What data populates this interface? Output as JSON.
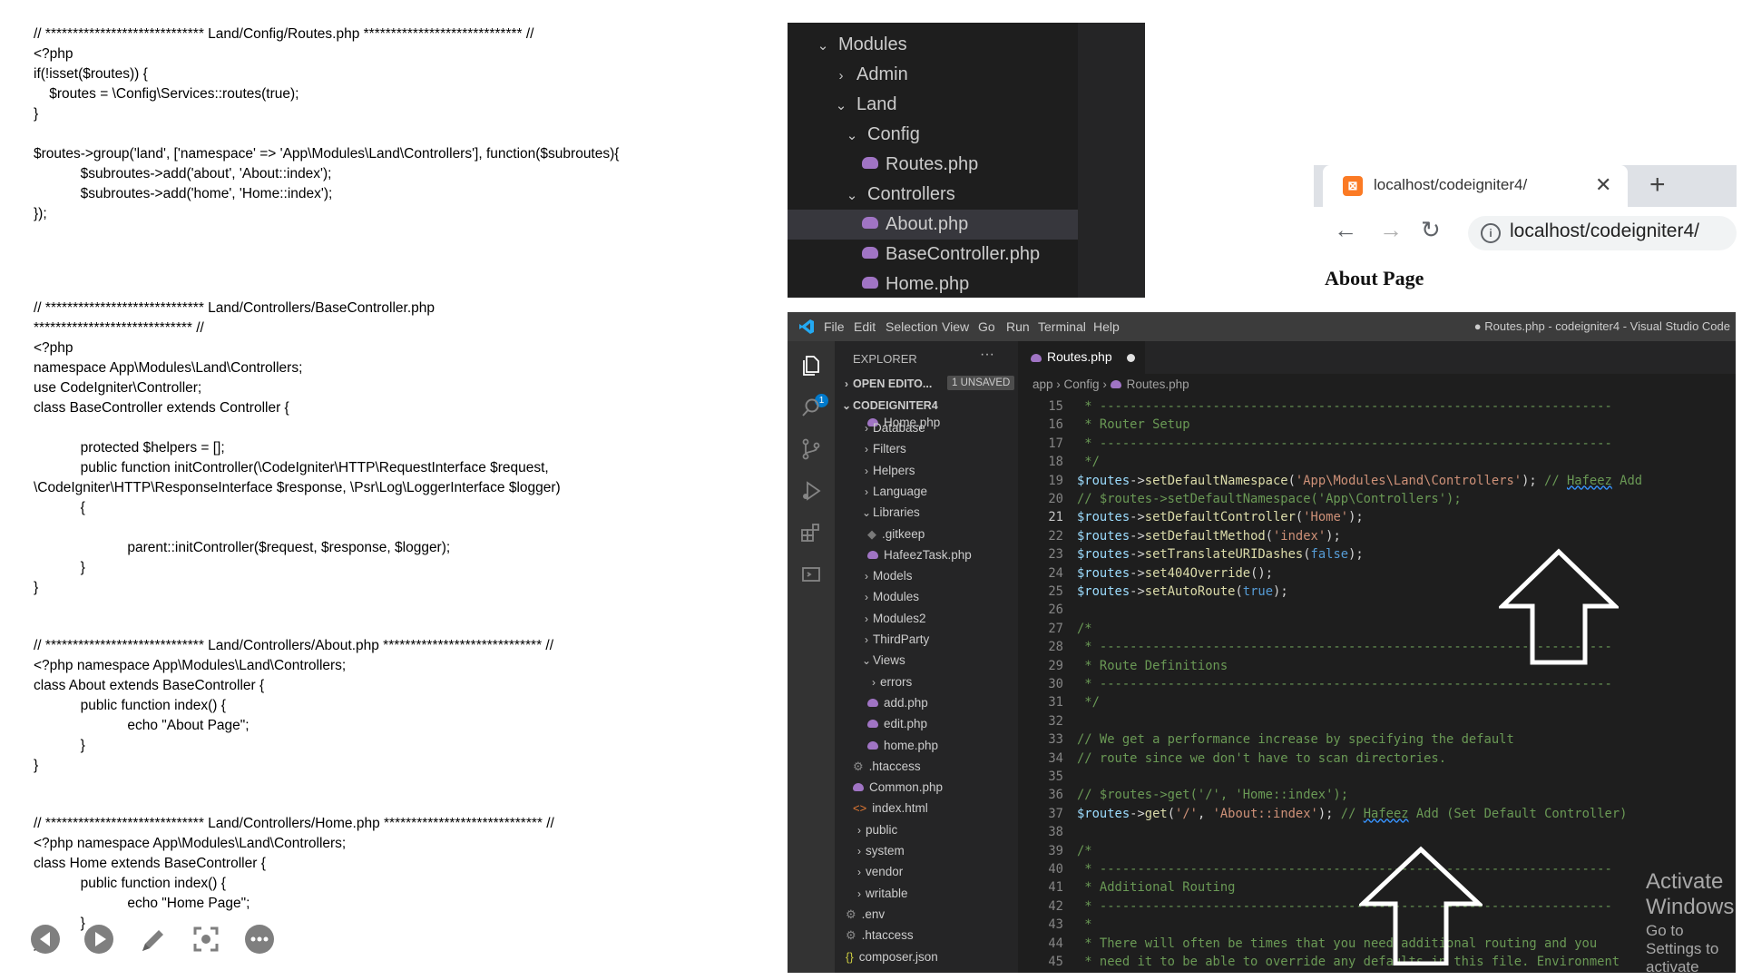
{
  "document": {
    "lines": [
      {
        "text": "// ***************************** Land/Config/Routes.php ***************************** //"
      },
      {
        "text": "<?php"
      },
      {
        "text": "if(!isset($routes)) {"
      },
      {
        "text": "    $routes = \\Config\\Services::routes(true);"
      },
      {
        "text": "}"
      },
      {
        "text": ""
      },
      {
        "text": "$routes->group('land', ['namespace' => 'App\\Modules\\Land\\Controllers'], function($subroutes){"
      },
      {
        "text": "            $subroutes->add('about', 'About::index');"
      },
      {
        "text": "            $subroutes->add('home', 'Home::index');"
      },
      {
        "text": "});"
      },
      {
        "text": "// ***************************** Land/Controllers/BaseController.php"
      },
      {
        "text": "***************************** //"
      },
      {
        "text": "<?php"
      },
      {
        "text": "namespace App\\Modules\\Land\\Controllers;"
      },
      {
        "text": "use CodeIgniter\\Controller;"
      },
      {
        "text": "class BaseController extends Controller {"
      },
      {
        "text": ""
      },
      {
        "text": "            protected $helpers = [];"
      },
      {
        "text": "            public function initController(\\CodeIgniter\\HTTP\\RequestInterface $request,"
      },
      {
        "text": "\\CodeIgniter\\HTTP\\ResponseInterface $response, \\Psr\\Log\\LoggerInterface $logger)"
      },
      {
        "text": "            {"
      },
      {
        "text": ""
      },
      {
        "text": "                        parent::initController($request, $response, $logger);"
      },
      {
        "text": "            }"
      },
      {
        "text": "}"
      },
      {
        "text": "// ***************************** Land/Controllers/About.php ***************************** //"
      },
      {
        "text": "<?php namespace App\\Modules\\Land\\Controllers;"
      },
      {
        "text": "class About extends BaseController {"
      },
      {
        "text": "            public function index() {"
      },
      {
        "text": "                        echo \"About Page\";"
      },
      {
        "text": "            }"
      },
      {
        "text": "}"
      },
      {
        "text": "// ***************************** Land/Controllers/Home.php ***************************** //"
      },
      {
        "text": "<?php namespace App\\Modules\\Land\\Controllers;"
      },
      {
        "text": "class Home extends BaseController {"
      },
      {
        "text": "            public function index() {"
      },
      {
        "text": "                        echo \"Home Page\";"
      },
      {
        "text": "            }"
      },
      {
        "text": "}"
      }
    ]
  },
  "tree_panel": {
    "items": [
      {
        "label": "Modules",
        "chevron": "v"
      },
      {
        "label": "Admin",
        "chevron": ">"
      },
      {
        "label": "Land",
        "chevron": "v"
      },
      {
        "label": "Config",
        "chevron": "v"
      },
      {
        "label": "Routes.php",
        "icon": "php-elephant-icon"
      },
      {
        "label": "Controllers",
        "chevron": "v"
      },
      {
        "label": "About.php",
        "icon": "php-elephant-icon",
        "selected": true
      },
      {
        "label": "BaseController.php",
        "icon": "php-elephant-icon"
      },
      {
        "label": "Home.php",
        "icon": "php-elephant-icon"
      }
    ]
  },
  "browser": {
    "tab_title": "localhost/codeigniter4/",
    "url": "localhost/codeigniter4/",
    "page_text": "About Page"
  },
  "vscode": {
    "menu": [
      "File",
      "Edit",
      "Selection",
      "View",
      "Go",
      "Run",
      "Terminal",
      "Help"
    ],
    "window_title": "● Routes.php - codeigniter4 - Visual Studio Code",
    "explorer_title": "EXPLORER",
    "explorer_more": "···",
    "open_editors": "OPEN EDITO...",
    "unsaved_badge": "1 UNSAVED",
    "project": "CODEIGNITER4",
    "activity_badge": "1",
    "sidebar": [
      {
        "label": "Home.php",
        "chevron": "",
        "icon": "php"
      },
      {
        "label": "Database",
        "chevron": ">"
      },
      {
        "label": "Filters",
        "chevron": ">"
      },
      {
        "label": "Helpers",
        "chevron": ">"
      },
      {
        "label": "Language",
        "chevron": ">"
      },
      {
        "label": "Libraries",
        "chevron": "v"
      },
      {
        "label": ".gitkeep",
        "icon": "git"
      },
      {
        "label": "HafeezTask.php",
        "icon": "php"
      },
      {
        "label": "Models",
        "chevron": ">"
      },
      {
        "label": "Modules",
        "chevron": ">"
      },
      {
        "label": "Modules2",
        "chevron": ">"
      },
      {
        "label": "ThirdParty",
        "chevron": ">"
      },
      {
        "label": "Views",
        "chevron": "v"
      },
      {
        "label": "errors",
        "chevron": ">"
      },
      {
        "label": "add.php",
        "icon": "php"
      },
      {
        "label": "edit.php",
        "icon": "php"
      },
      {
        "label": "home.php",
        "icon": "php"
      },
      {
        "label": ".htaccess",
        "icon": "gear"
      },
      {
        "label": "Common.php",
        "icon": "php"
      },
      {
        "label": "index.html",
        "icon": "html"
      },
      {
        "label": "public",
        "chevron": ">"
      },
      {
        "label": "system",
        "chevron": ">"
      },
      {
        "label": "vendor",
        "chevron": ">"
      },
      {
        "label": "writable",
        "chevron": ">"
      },
      {
        "label": ".env",
        "icon": "gear"
      },
      {
        "label": ".htaccess",
        "icon": "gear"
      },
      {
        "label": "composer.json",
        "icon": "json"
      }
    ],
    "tab_label": "Routes.php",
    "breadcrumb": [
      "app",
      "Config",
      "Routes.php"
    ],
    "code_lines": [
      {
        "n": "15",
        "t": " * --------------------------------------------------------------------"
      },
      {
        "n": "16",
        "t": " * Router Setup"
      },
      {
        "n": "17",
        "t": " * --------------------------------------------------------------------"
      },
      {
        "n": "18",
        "t": " */"
      },
      {
        "n": "19",
        "t": "$routes->setDefaultNamespace('App\\Modules\\Land\\Controllers'); // Hafeez Add"
      },
      {
        "n": "20",
        "t": "// $routes->setDefaultNamespace('App\\Controllers');"
      },
      {
        "n": "21",
        "t": "$routes->setDefaultController('Home');"
      },
      {
        "n": "22",
        "t": "$routes->setDefaultMethod('index');"
      },
      {
        "n": "23",
        "t": "$routes->setTranslateURIDashes(false);"
      },
      {
        "n": "24",
        "t": "$routes->set404Override();"
      },
      {
        "n": "25",
        "t": "$routes->setAutoRoute(true);"
      },
      {
        "n": "26",
        "t": ""
      },
      {
        "n": "27",
        "t": "/*"
      },
      {
        "n": "28",
        "t": " * --------------------------------------------------------------------"
      },
      {
        "n": "29",
        "t": " * Route Definitions"
      },
      {
        "n": "30",
        "t": " * --------------------------------------------------------------------"
      },
      {
        "n": "31",
        "t": " */"
      },
      {
        "n": "32",
        "t": ""
      },
      {
        "n": "33",
        "t": "// We get a performance increase by specifying the default"
      },
      {
        "n": "34",
        "t": "// route since we don't have to scan directories."
      },
      {
        "n": "35",
        "t": ""
      },
      {
        "n": "36",
        "t": "// $routes->get('/', 'Home::index');"
      },
      {
        "n": "37",
        "t": "$routes->get('/', 'About::index'); // Hafeez Add (Set Default Controller)"
      },
      {
        "n": "38",
        "t": ""
      },
      {
        "n": "39",
        "t": "/*"
      },
      {
        "n": "40",
        "t": " * --------------------------------------------------------------------"
      },
      {
        "n": "41",
        "t": " * Additional Routing"
      },
      {
        "n": "42",
        "t": " * --------------------------------------------------------------------"
      },
      {
        "n": "43",
        "t": " *"
      },
      {
        "n": "44",
        "t": " * There will often be times that you need additional routing and you"
      },
      {
        "n": "45",
        "t": " * need it to be able to override any defaults in this file. Environment"
      }
    ],
    "activate_windows_title": "Activate Windows",
    "activate_windows_sub": "Go to Settings to activate Windows."
  }
}
